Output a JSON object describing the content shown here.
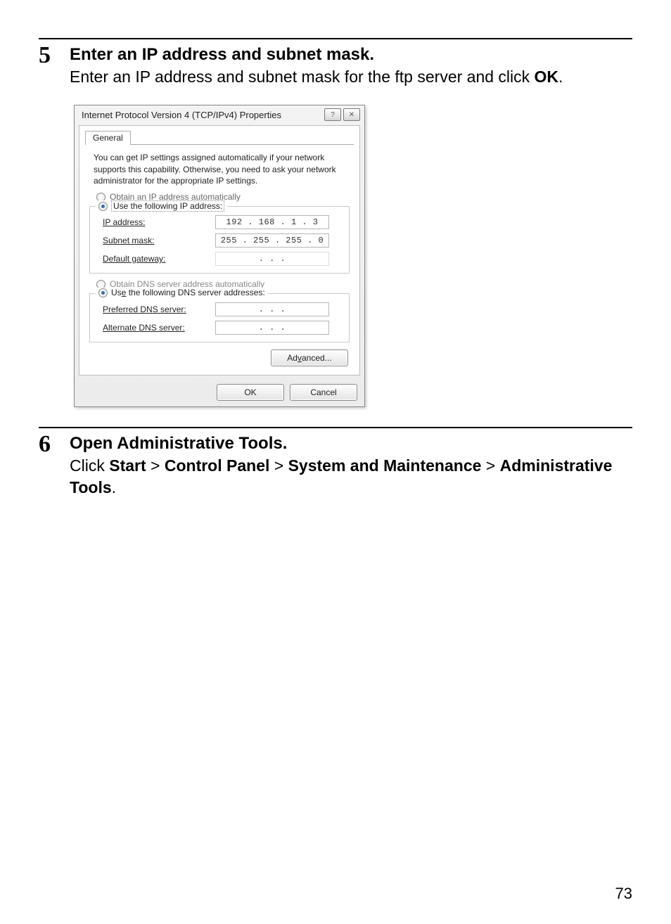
{
  "page_number": "73",
  "steps": [
    {
      "num": "5",
      "heading": "Enter an IP address and subnet mask.",
      "desc_pre": "Enter an IP address and subnet mask for the ftp server and click ",
      "desc_bold": "OK",
      "desc_post": "."
    },
    {
      "num": "6",
      "heading": "Open Administrative Tools.",
      "path_pre": "Click ",
      "path_parts": [
        "Start",
        "Control Panel",
        "System and Maintenance",
        "Administrative Tools"
      ],
      "path_sep": " > ",
      "path_post": "."
    }
  ],
  "dialog": {
    "title": "Internet Protocol Version 4 (TCP/IPv4) Properties",
    "tab": "General",
    "description": "You can get IP settings assigned automatically if your network supports this capability. Otherwise, you need to ask your network administrator for the appropriate IP settings.",
    "ip_radios": {
      "auto": "Obtain an IP address automatically",
      "manual": "Use the following IP address:"
    },
    "fields": {
      "ip_label": "IP address:",
      "ip_value": "192 . 168 .   1  .   3",
      "subnet_label": "Subnet mask:",
      "subnet_value": "255 . 255 . 255 .   0",
      "gateway_label": "Default gateway:",
      "gateway_value": " .          .          . "
    },
    "dns_radios": {
      "auto": "Obtain DNS server address automatically",
      "manual": "Use the following DNS server addresses:"
    },
    "dns_fields": {
      "preferred_label": "Preferred DNS server:",
      "alternate_label": "Alternate DNS server:",
      "blank_value": " .          .          . "
    },
    "buttons": {
      "advanced": "Advanced...",
      "ok": "OK",
      "cancel": "Cancel"
    },
    "winbtns": {
      "help": "?",
      "close": "✕"
    }
  }
}
